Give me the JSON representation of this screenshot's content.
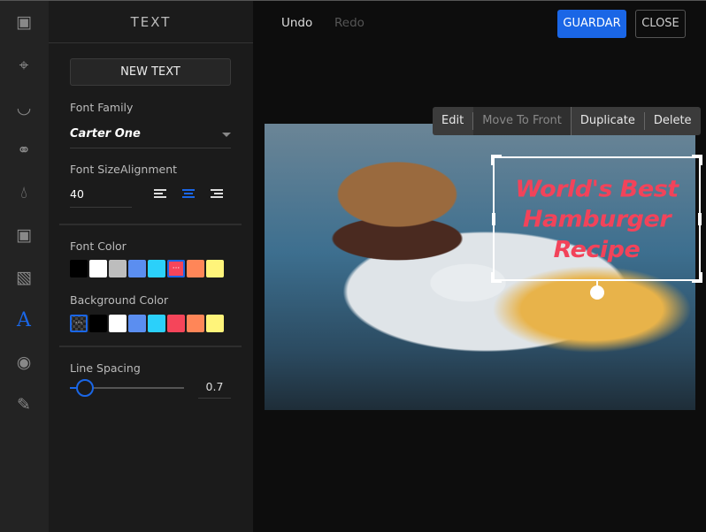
{
  "sidebar": {
    "icons": [
      "image-icon",
      "crop-icon",
      "filter-flask-icon",
      "adjust-sliders-icon",
      "drop-icon",
      "frame-icon",
      "overlay-icon",
      "text-icon",
      "sticker-icon",
      "brush-icon"
    ],
    "active": "text-icon"
  },
  "panel": {
    "title": "TEXT",
    "new_text": "NEW TEXT",
    "font_family_label": "Font Family",
    "font_family": "Carter One",
    "font_size_label": "Font Size",
    "font_size": "40",
    "alignment_label": "Alignment",
    "alignment": "center",
    "font_color_label": "Font Color",
    "font_colors": [
      "#000000",
      "#ffffff",
      "#bdbdbd",
      "#5b8ef0",
      "#2bd0fa",
      "#f5455a",
      "#ff8658",
      "#fff47a"
    ],
    "font_color_selected": 5,
    "background_color_label": "Background Color",
    "background_colors": [
      "transparent",
      "#000000",
      "#ffffff",
      "#5b8ef0",
      "#2bd0fa",
      "#f5455a",
      "#ff8658",
      "#fff47a"
    ],
    "background_color_selected": 0,
    "line_spacing_label": "Line Spacing",
    "line_spacing": "0.7"
  },
  "toolbar": {
    "undo": "Undo",
    "redo": "Redo",
    "save": "GUARDAR",
    "close": "CLOSE"
  },
  "context_menu": {
    "edit": "Edit",
    "move_to_front": "Move To Front",
    "duplicate": "Duplicate",
    "delete": "Delete"
  },
  "canvas": {
    "text_lines": [
      "World's Best",
      "Hamburger",
      "Recipe"
    ],
    "text_color": "#f2435a",
    "accent": "#1a66e6"
  }
}
